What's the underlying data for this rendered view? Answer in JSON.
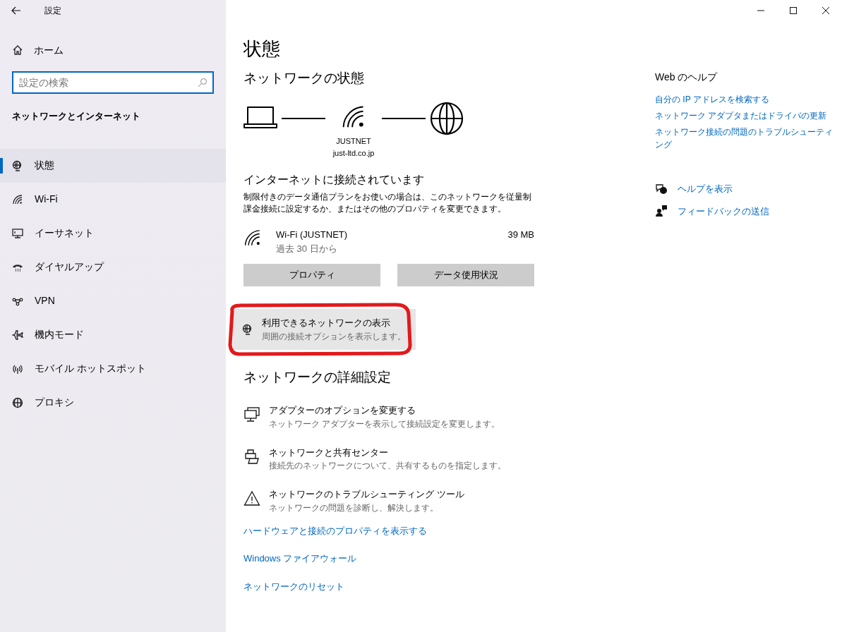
{
  "window": {
    "title": "設定"
  },
  "sidebar": {
    "home": "ホーム",
    "search": {
      "placeholder": "設定の検索"
    },
    "section": "ネットワークとインターネット",
    "items": [
      {
        "kind": "status",
        "label": "状態",
        "selected": true
      },
      {
        "kind": "wifi",
        "label": "Wi-Fi",
        "selected": false
      },
      {
        "kind": "ethernet",
        "label": "イーサネット",
        "selected": false
      },
      {
        "kind": "dialup",
        "label": "ダイヤルアップ",
        "selected": false
      },
      {
        "kind": "vpn",
        "label": "VPN",
        "selected": false
      },
      {
        "kind": "airplane",
        "label": "機内モード",
        "selected": false
      },
      {
        "kind": "hotspot",
        "label": "モバイル ホットスポット",
        "selected": false
      },
      {
        "kind": "proxy",
        "label": "プロキシ",
        "selected": false
      }
    ]
  },
  "main": {
    "title": "状態",
    "network_status": {
      "heading": "ネットワークの状態",
      "ssid": "JUSTNET",
      "domain": "just-ltd.co.jp",
      "connected": "インターネットに接続されています",
      "description": "制限付きのデータ通信プランをお使いの場合は、このネットワークを従量制課金接続に設定するか、またはその他のプロパティを変更できます。",
      "connection": {
        "name": "Wi-Fi (JUSTNET)",
        "period": "過去 30 日から",
        "usage": "39 MB"
      },
      "buttons": [
        "プロパティ",
        "データ使用状況"
      ],
      "show_networks": {
        "title": "利用できるネットワークの表示",
        "subtitle": "周囲の接続オプションを表示します。"
      }
    },
    "advanced": {
      "heading": "ネットワークの詳細設定",
      "items": [
        {
          "kind": "adapter",
          "title": "アダプターのオプションを変更する",
          "subtitle": "ネットワーク アダプターを表示して接続設定を変更します。"
        },
        {
          "kind": "sharing",
          "title": "ネットワークと共有センター",
          "subtitle": "接続先のネットワークについて、共有するものを指定します。"
        },
        {
          "kind": "troubleshoot",
          "title": "ネットワークのトラブルシューティング ツール",
          "subtitle": "ネットワークの問題を診断し、解決します。"
        }
      ],
      "links": [
        "ハードウェアと接続のプロパティを表示する",
        "Windows ファイアウォール",
        "ネットワークのリセット"
      ]
    }
  },
  "help": {
    "heading": "Web のヘルプ",
    "links": [
      "自分の IP アドレスを検索する",
      "ネットワーク アダプタまたはドライバの更新",
      "ネットワーク接続の問題のトラブルシューティング"
    ],
    "actions": [
      {
        "kind": "help",
        "label": "ヘルプを表示"
      },
      {
        "kind": "feedback",
        "label": "フィードバックの送信"
      }
    ]
  }
}
